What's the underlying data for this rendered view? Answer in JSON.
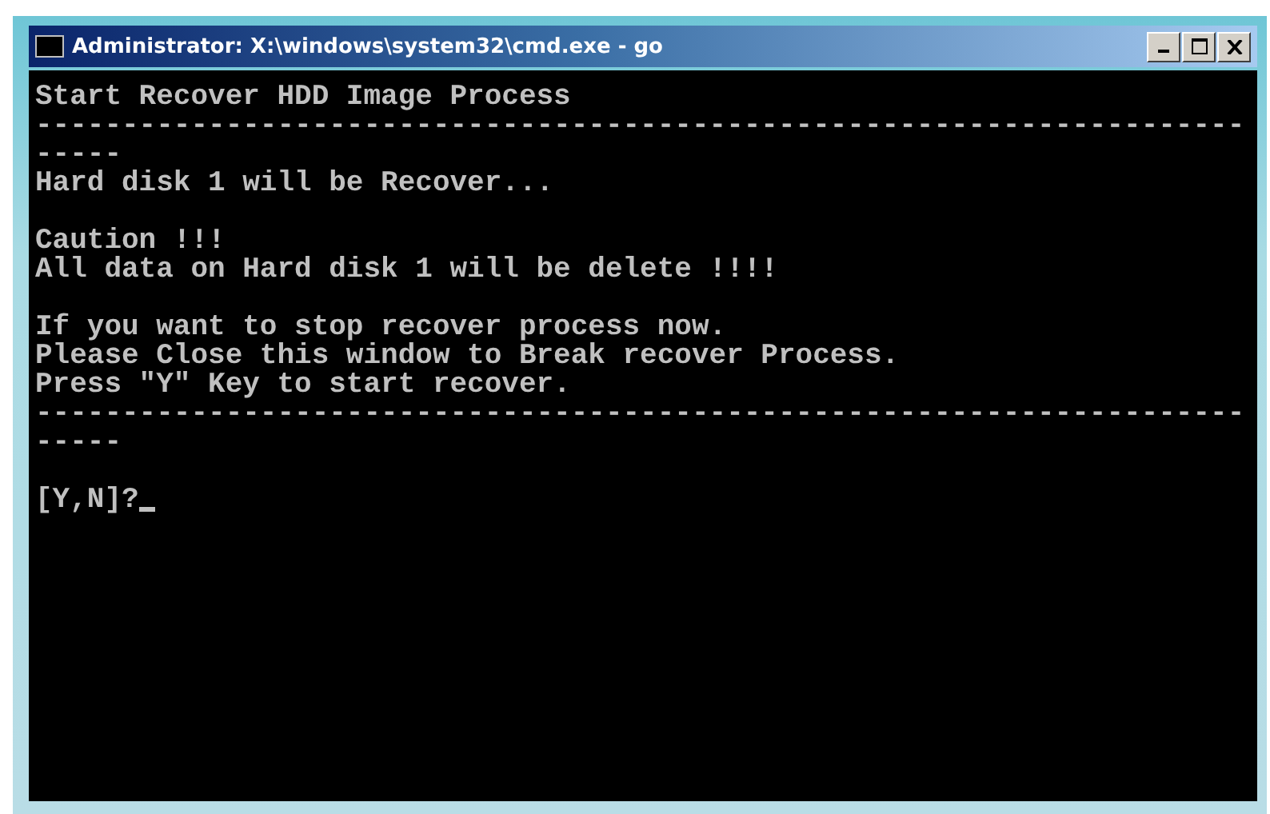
{
  "window": {
    "title": "Administrator: X:\\windows\\system32\\cmd.exe - go"
  },
  "console": {
    "blocks": [
      [
        "Start Recover HDD Image Process",
        "----------------------------------------------------------------------",
        "-----",
        "Hard disk 1 will be Recover..."
      ],
      [
        "Caution !!!",
        "All data on Hard disk 1 will be delete !!!!"
      ],
      [
        "If you want to stop recover process now.",
        "Please Close this window to Break recover Process.",
        "Press \"Y\" Key to start recover.",
        "----------------------------------------------------------------------",
        "-----"
      ]
    ],
    "prompt": "[Y,N]?"
  }
}
